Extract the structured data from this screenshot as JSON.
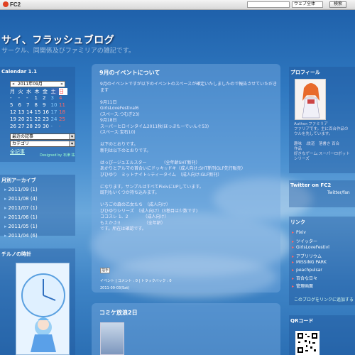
{
  "fc2bar": {
    "logo": "FC2",
    "select_value": "ウェブ全体",
    "search_button": "検索"
  },
  "header": {
    "title": "サイ、フラッシュブログ",
    "description": "サークル、同関係及びファミリアの雑記です。"
  },
  "calendar": {
    "heading": "Calendar 1.1",
    "prev": "«",
    "next": "»",
    "month": "2011年09月",
    "weekdays": [
      "月",
      "火",
      "水",
      "木",
      "金",
      "土",
      "日"
    ],
    "rows": [
      [
        "-",
        "-",
        "-",
        "1",
        "2",
        "3",
        "4"
      ],
      [
        "5",
        "6",
        "7",
        "8",
        "9",
        "10",
        "11"
      ],
      [
        "12",
        "13",
        "14",
        "15",
        "16",
        "17",
        "18"
      ],
      [
        "19",
        "20",
        "21",
        "22",
        "23",
        "24",
        "25"
      ],
      [
        "26",
        "27",
        "28",
        "29",
        "30",
        "-",
        "-"
      ]
    ],
    "select_recent": "最近の記事",
    "select_category": "カテゴリ",
    "all_posts": "全記事",
    "designed_by": "Designed by 石津 祐"
  },
  "archive": {
    "heading": "月別アーカイブ",
    "items": [
      "2011/09 (1)",
      "2011/08 (4)",
      "2011/07 (1)",
      "2011/06 (1)",
      "2011/05 (1)",
      "2011/04 (6)"
    ]
  },
  "clock": {
    "heading": "チルノの時計"
  },
  "post": {
    "title": "9月のイベントについて",
    "lines": [
      "9月のイベントですが以下のイベントのスペースが確定いたしましたので報告させていただきます",
      "",
      "9月11日",
      "GirlsLoveFestival6",
      "(スペース:つむぎ23)",
      "9月18日",
      "スーパーヒロインタイム2011秋(ほっぷたーでぃんぐ53)",
      "(スペース:宝石10)",
      "",
      "以下のとおりです。",
      "新刊は以下のとおりです。",
      "",
      "はっぴージュエルスター　　　　（全年齢SHT新刊）",
      "あかりとアルマの首合いにドッキ☆ドキ（成人向け:SHT新刊GLF先行販売）",
      "びひゆり　ミットナイト☆ティータイム　（成人向け:GLF新刊）",
      "",
      "になります。サンプルはすべてPixivにUPしています。",
      "既刊もいくつか持ち込みます。",
      "",
      "いろごの森の乙女たち　（成人向け）",
      "びひゆりシリーズ　（成人向け）(3巻目は少数です)",
      "ココスレ 1、2　　　　（成人向け）",
      "もえかさ!!　　　　　　（全年齢）",
      "です。所在は確認です。"
    ],
    "clap_label": "拍手",
    "meta": "イベント | コメント : 0 | トラックバック : 0",
    "date": "2011-09-03(Sat)"
  },
  "post2": {
    "title": "コミケ放浪2日"
  },
  "profile": {
    "heading": "プロフィール",
    "lines": [
      "Author:ファミリア",
      "ファリアです。主に百合作品の",
      "ウルを先しています。",
      "",
      "趣味　:鉄道　落書き 百合",
      "作品",
      "好きなゲーム:スーパーロボット",
      "シリーズ"
    ]
  },
  "twitter": {
    "heading": "Twitter on FC2",
    "link": "Twitter/fan"
  },
  "links": {
    "heading": "リンク",
    "items": [
      "Pixiv",
      "ツイッター",
      "GirlsLoveFestivl",
      "アブリリウム",
      "MISSING PARK",
      "peachpulsar",
      "百合な日々",
      "管理画面"
    ],
    "add_link": "このブログをリンクに追加する"
  },
  "qr": {
    "heading": "QRコード"
  },
  "colors": {
    "accent": "#1d5ea8",
    "sunday": "#ff3333",
    "link_bullet": "#ff6666"
  }
}
